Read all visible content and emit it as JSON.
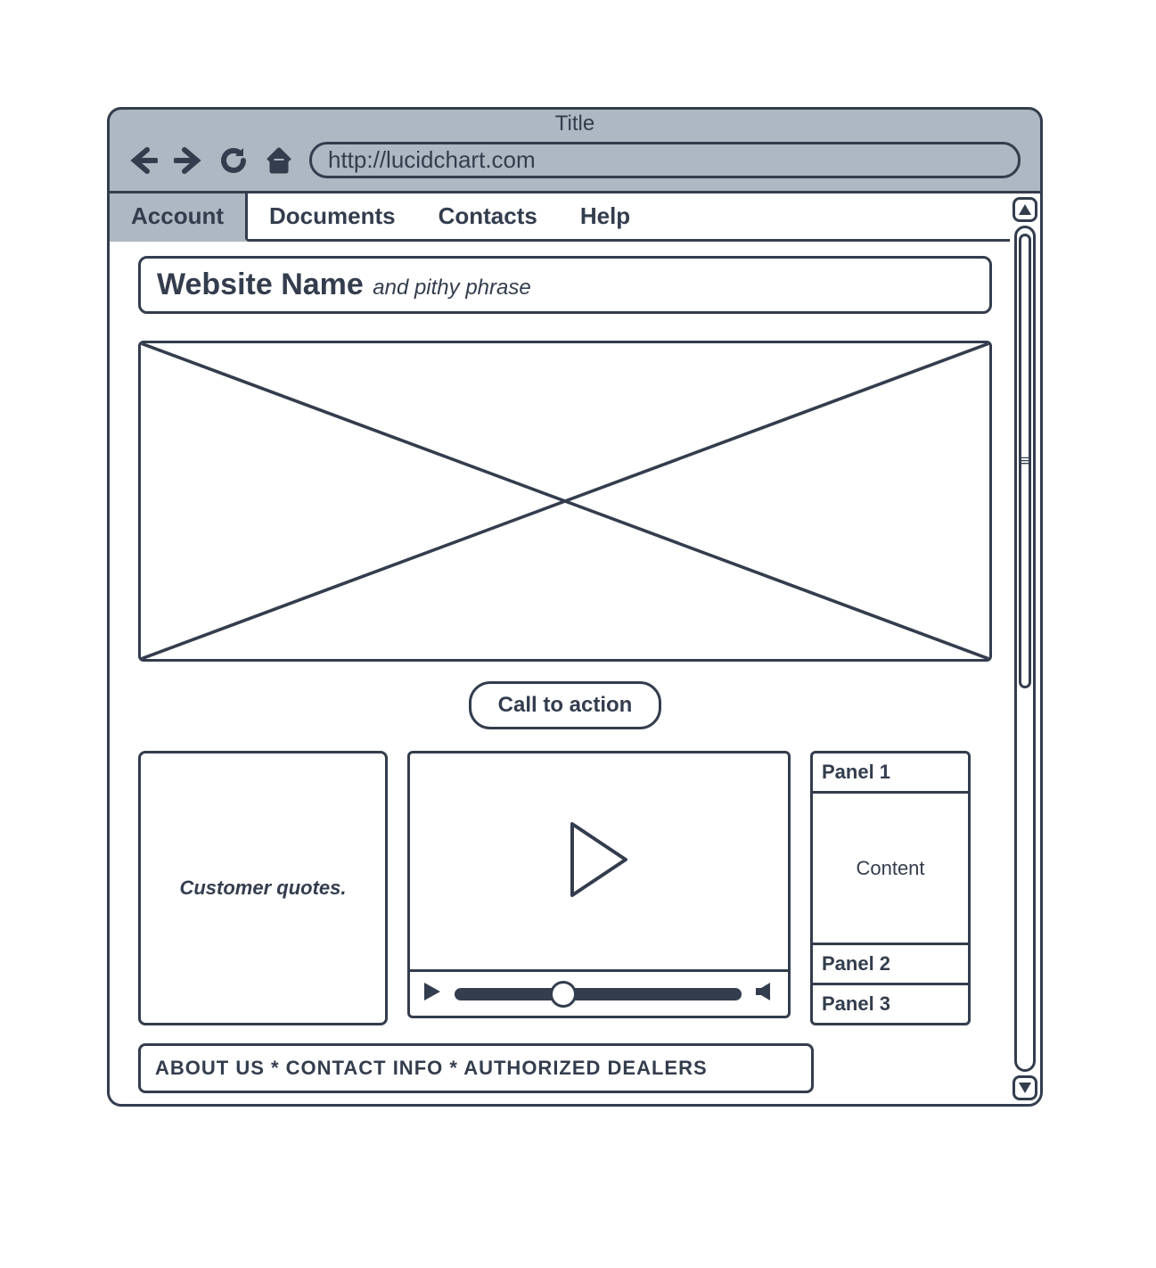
{
  "browser": {
    "title": "Title",
    "url": "http://lucidchart.com"
  },
  "tabs": [
    {
      "label": "Account",
      "active": true
    },
    {
      "label": "Documents",
      "active": false
    },
    {
      "label": "Contacts",
      "active": false
    },
    {
      "label": "Help",
      "active": false
    }
  ],
  "header": {
    "site_name": "Website Name",
    "tagline": "and pithy phrase"
  },
  "cta": {
    "label": "Call to action"
  },
  "quotes": {
    "text": "Customer quotes."
  },
  "accordion": {
    "panels": [
      {
        "title": "Panel 1",
        "content": "Content"
      },
      {
        "title": "Panel 2"
      },
      {
        "title": "Panel 3"
      }
    ]
  },
  "footer": {
    "text": "ABOUT US  * CONTACT INFO * AUTHORIZED DEALERS"
  }
}
